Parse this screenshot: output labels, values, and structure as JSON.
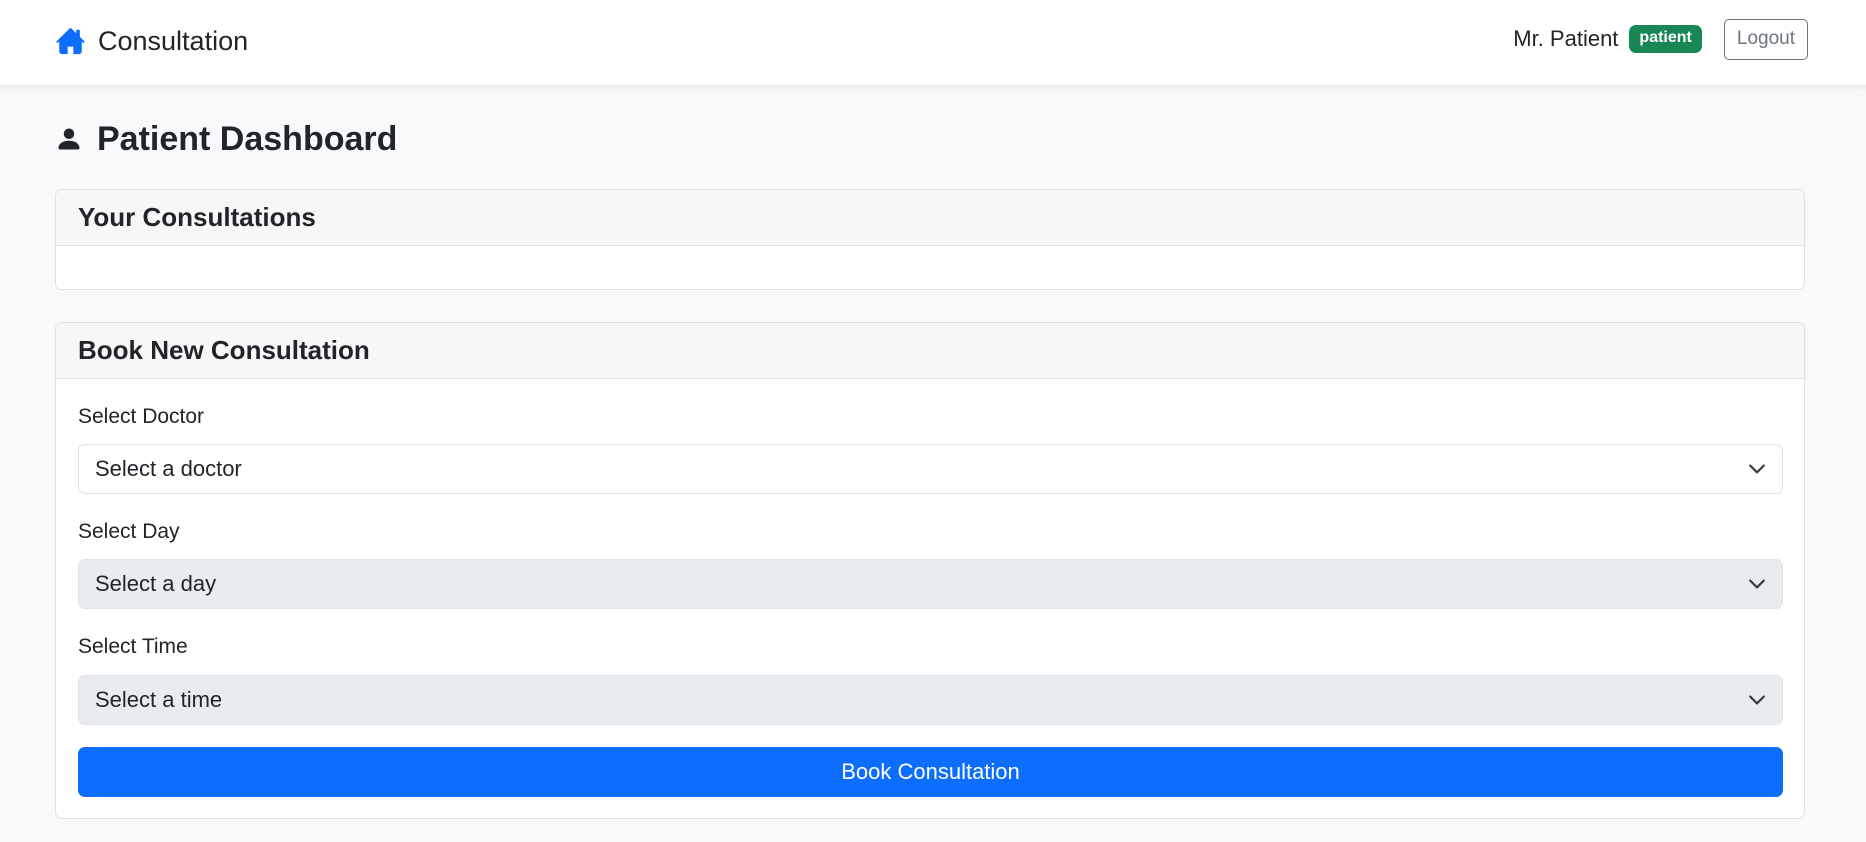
{
  "navbar": {
    "brand_label": "Consultation",
    "brand_icon": "home-icon",
    "user_name": "Mr. Patient",
    "role_badge": "patient",
    "logout_label": "Logout"
  },
  "page": {
    "title": "Patient Dashboard",
    "title_icon": "person-icon"
  },
  "consultations_card": {
    "title": "Your Consultations"
  },
  "booking_card": {
    "title": "Book New Consultation",
    "doctor_label": "Select Doctor",
    "doctor_value": "Select a doctor",
    "day_label": "Select Day",
    "day_value": "Select a day",
    "time_label": "Select Time",
    "time_value": "Select a time",
    "submit_label": "Book Consultation"
  },
  "colors": {
    "primary": "#0d6efd",
    "success_badge": "#198754",
    "disabled_select": "#e9ecef"
  }
}
